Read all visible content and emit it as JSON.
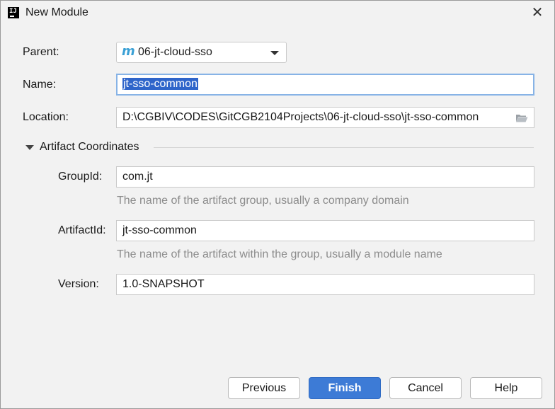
{
  "window": {
    "title": "New Module",
    "app_icon_text": "IJ",
    "close_glyph": "✕"
  },
  "form": {
    "parent_label": "Parent:",
    "parent_value": "06-jt-cloud-sso",
    "parent_icon_glyph": "m",
    "name_label": "Name:",
    "name_value": "jt-sso-common",
    "location_label": "Location:",
    "location_value": "D:\\CGBIV\\CODES\\GitCGB2104Projects\\06-jt-cloud-sso\\jt-sso-common"
  },
  "artifact": {
    "section_title": "Artifact Coordinates",
    "groupid_label": "GroupId:",
    "groupid_value": "com.jt",
    "groupid_hint": "The name of the artifact group, usually a company domain",
    "artifactid_label": "ArtifactId:",
    "artifactid_value": "jt-sso-common",
    "artifactid_hint": "The name of the artifact within the group, usually a module name",
    "version_label": "Version:",
    "version_value": "1.0-SNAPSHOT"
  },
  "buttons": {
    "previous": "Previous",
    "finish": "Finish",
    "cancel": "Cancel",
    "help": "Help"
  },
  "icons": {
    "app": "intellij-icon",
    "maven": "maven-module-icon",
    "folder": "folder-open-icon",
    "collapse": "triangle-down-icon",
    "close": "close-icon"
  },
  "colors": {
    "accent": "#3d7bd6",
    "selection": "#2f65ca",
    "focus_border": "#87b3e6",
    "hint_text": "#8c8c8c",
    "maven_icon": "#3aa0d5"
  }
}
